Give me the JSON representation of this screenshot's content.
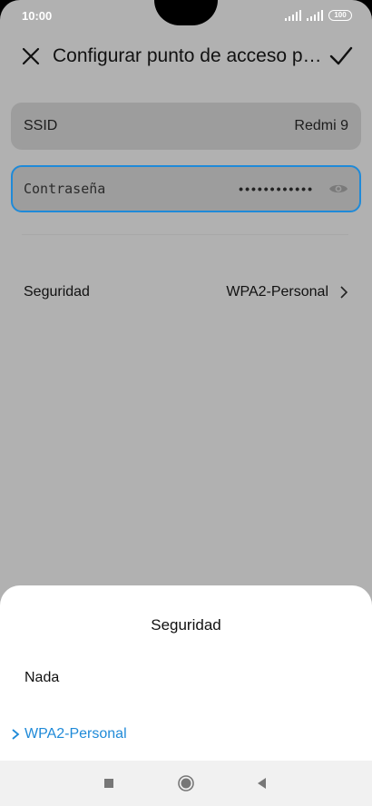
{
  "status_bar": {
    "time": "10:00",
    "battery": "100"
  },
  "header": {
    "title": "Configurar punto de acceso po...",
    "close_icon": "close-icon",
    "confirm_icon": "check-icon"
  },
  "fields": {
    "ssid_label": "SSID",
    "ssid_value": "Redmi 9",
    "password_label": "Contraseña",
    "password_value": "••••••••••••"
  },
  "security": {
    "label": "Seguridad",
    "value": "WPA2-Personal"
  },
  "sheet": {
    "title": "Seguridad",
    "options": [
      {
        "label": "Nada",
        "selected": false
      },
      {
        "label": "WPA2-Personal",
        "selected": true
      }
    ]
  },
  "colors": {
    "accent": "#1f8ad8",
    "dim_overlay": "#b1b1b1"
  }
}
